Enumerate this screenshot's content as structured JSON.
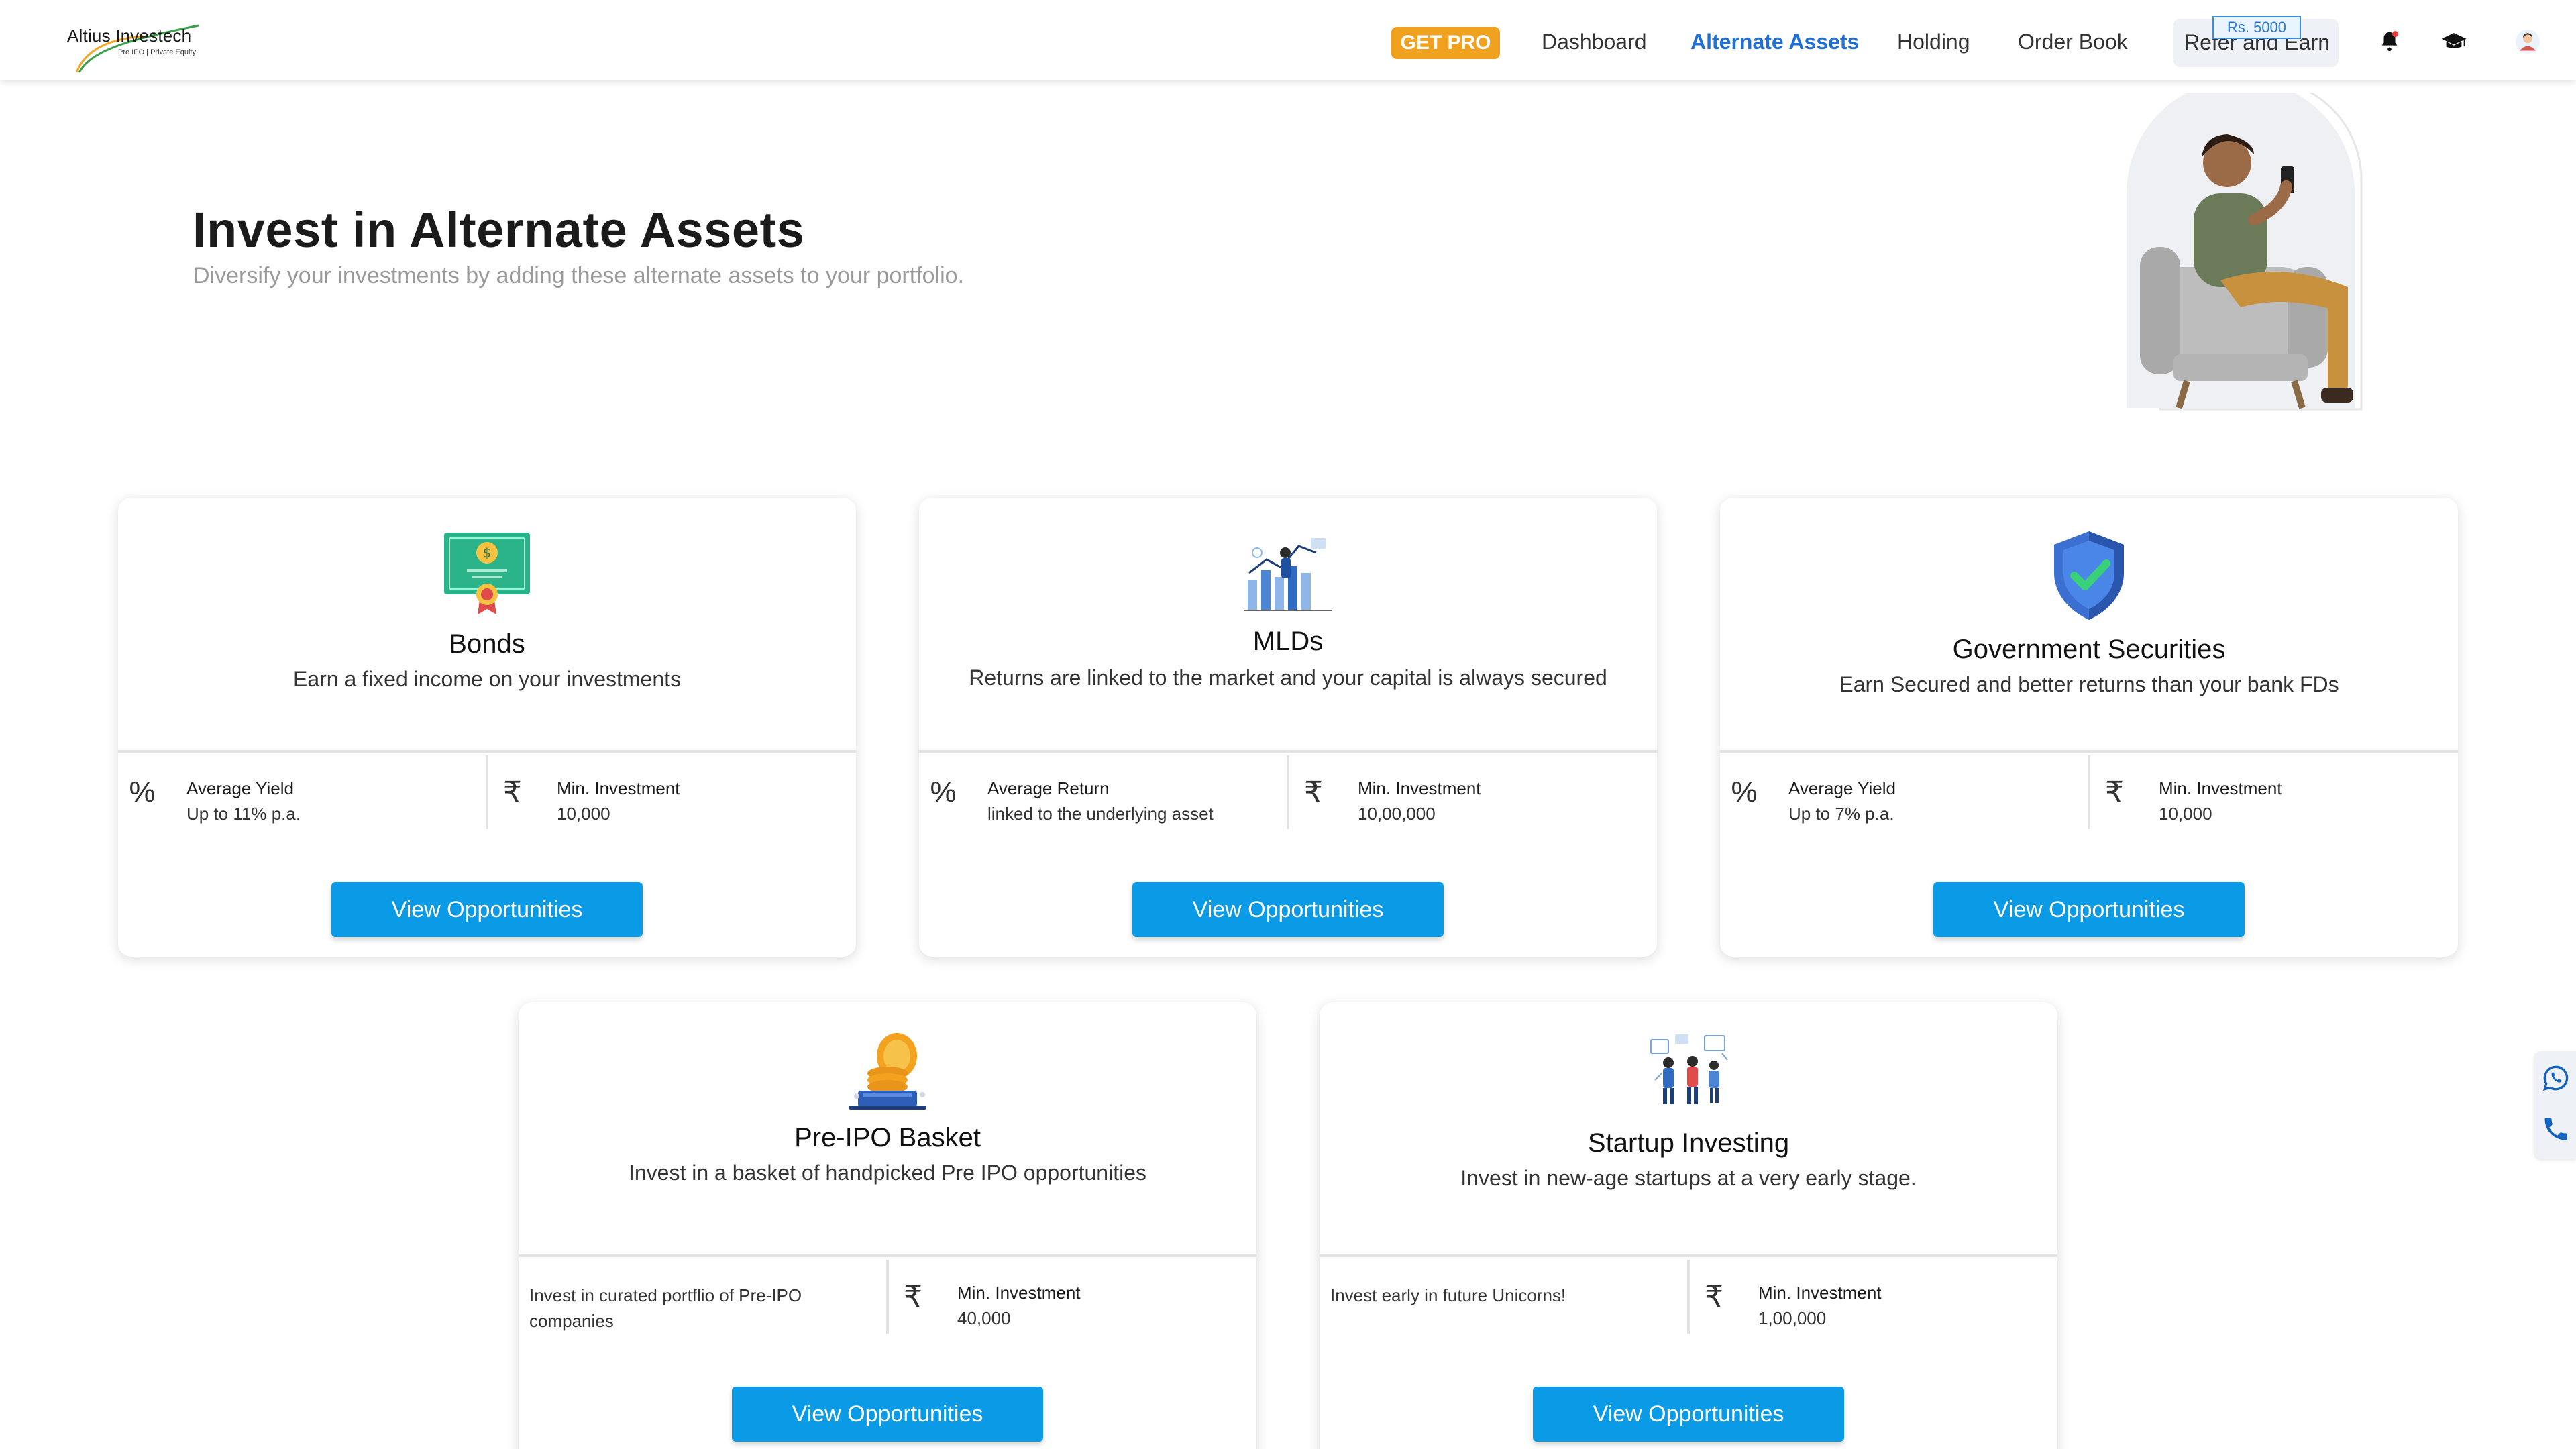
{
  "header": {
    "logo": {
      "title": "Altius Investech",
      "subtitle": "Pre IPO | Private Equity"
    },
    "get_pro": "GET PRO",
    "nav": [
      "Dashboard",
      "Alternate Assets",
      "Holding",
      "Order Book"
    ],
    "active_nav": "Alternate Assets",
    "refer": {
      "label": "Refer and Earn",
      "badge": "Rs. 5000"
    },
    "icons": [
      "bell-icon",
      "graduation-cap-icon",
      "user-avatar-icon"
    ]
  },
  "hero": {
    "title": "Invest in Alternate Assets",
    "subtitle": "Diversify your investments by adding these alternate assets to your portfolio."
  },
  "cards": [
    {
      "icon": "bond-certificate-icon",
      "title": "Bonds",
      "description": "Earn a fixed income on your investments",
      "left": {
        "symbol": "%",
        "label": "Average Yield",
        "value": "Up to 11% p.a."
      },
      "right": {
        "symbol": "₹",
        "label": "Min. Investment",
        "value": "10,000"
      },
      "button": "View Opportunities"
    },
    {
      "icon": "market-chart-icon",
      "title": "MLDs",
      "description": "Returns are linked to the market and your capital is always secured",
      "left": {
        "symbol": "%",
        "label": "Average Return",
        "value": "linked to the underlying asset"
      },
      "right": {
        "symbol": "₹",
        "label": "Min. Investment",
        "value": "10,00,000"
      },
      "button": "View Opportunities"
    },
    {
      "icon": "shield-check-icon",
      "title": "Government Securities",
      "description": "Earn Secured and better returns than your bank FDs",
      "left": {
        "symbol": "%",
        "label": "Average Yield",
        "value": "Up to 7% p.a."
      },
      "right": {
        "symbol": "₹",
        "label": "Min. Investment",
        "value": "10,000"
      },
      "button": "View Opportunities"
    },
    {
      "icon": "coin-basket-icon",
      "title": "Pre-IPO Basket",
      "description": "Invest in a basket of handpicked Pre IPO opportunities",
      "left": {
        "note": "Invest in curated portflio of Pre-IPO companies"
      },
      "right": {
        "symbol": "₹",
        "label": "Min. Investment",
        "value": "40,000"
      },
      "button": "View Opportunities"
    },
    {
      "icon": "startup-team-icon",
      "title": "Startup Investing",
      "description": "Invest in new-age startups at a very early stage.",
      "left": {
        "note": "Invest early in future Unicorns!"
      },
      "right": {
        "symbol": "₹",
        "label": "Min. Investment",
        "value": "1,00,000"
      },
      "button": "View Opportunities"
    }
  ],
  "floating": [
    "whatsapp-icon",
    "phone-icon"
  ],
  "colors": {
    "primary": "#0a9ae6",
    "active_nav": "#1f6fd6",
    "get_pro": "#f0a120"
  }
}
